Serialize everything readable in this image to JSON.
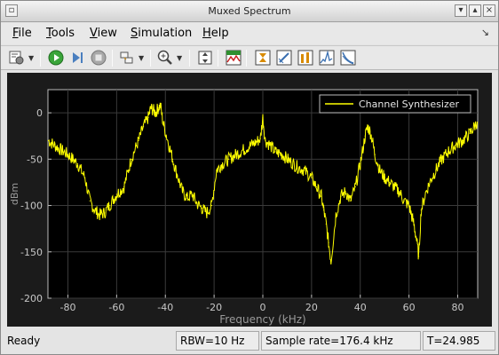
{
  "window": {
    "title": "Muxed Spectrum"
  },
  "menu": {
    "items": [
      "File",
      "Tools",
      "View",
      "Simulation",
      "Help"
    ]
  },
  "toolbar": {
    "icons": [
      "settings-icon",
      "run-icon",
      "step-forward-icon",
      "stop-icon",
      "highlight-icon",
      "zoom-in-icon",
      "fit-to-view-icon",
      "spectrum-type-icon",
      "cursor-measurements-icon",
      "channel-measurements-icon",
      "distortion-measurements-icon",
      "peak-finder-icon",
      "ccdf-icon"
    ]
  },
  "status": {
    "state": "Ready",
    "rbw": "RBW=10 Hz",
    "sample_rate": "Sample rate=176.4 kHz",
    "time": "T=24.985"
  },
  "colors": {
    "plot_background": "#000000",
    "trace": "#ffff00",
    "axes_text": "#c8c8c8",
    "grid": "#3a3a3a"
  },
  "chart_data": {
    "type": "line",
    "title": "",
    "xlabel": "Frequency (kHz)",
    "ylabel": "dBm",
    "xlim": [
      -88.2,
      88.2
    ],
    "ylim": [
      -200,
      25
    ],
    "xticks": [
      -80,
      -60,
      -40,
      -20,
      0,
      20,
      40,
      60,
      80
    ],
    "yticks": [
      0,
      -50,
      -100,
      -150,
      -200
    ],
    "grid": true,
    "legend_position": "top-right",
    "series": [
      {
        "name": "Channel Synthesizer",
        "x": [
          -88,
          -84,
          -80,
          -76,
          -73,
          -71,
          -69,
          -67,
          -65,
          -63,
          -60,
          -57,
          -54,
          -51,
          -49,
          -47,
          -46,
          -45,
          -44,
          -43,
          -42,
          -41,
          -39,
          -37,
          -35,
          -33,
          -31,
          -29,
          -27,
          -25,
          -23,
          -21,
          -19,
          -17,
          -14,
          -11,
          -8,
          -5,
          -3,
          -1,
          0,
          1,
          3,
          5,
          8,
          11,
          14,
          17,
          20,
          22,
          24,
          25,
          26,
          27,
          28,
          30,
          32,
          34,
          36,
          38,
          40,
          42,
          43,
          44,
          45,
          46,
          48,
          50,
          52,
          54,
          56,
          58,
          60,
          61,
          62,
          63,
          64,
          65,
          67,
          69,
          71,
          73,
          76,
          79,
          82,
          85,
          88
        ],
        "y": [
          -30,
          -38,
          -45,
          -55,
          -70,
          -95,
          -105,
          -110,
          -108,
          -100,
          -88,
          -80,
          -50,
          -30,
          -15,
          -5,
          5,
          3,
          0,
          5,
          8,
          -10,
          -30,
          -50,
          -68,
          -85,
          -92,
          -88,
          -98,
          -103,
          -108,
          -100,
          -62,
          -56,
          -50,
          -45,
          -40,
          -35,
          -32,
          -28,
          -5,
          -30,
          -35,
          -42,
          -45,
          -52,
          -58,
          -62,
          -70,
          -80,
          -90,
          -105,
          -120,
          -140,
          -160,
          -110,
          -90,
          -85,
          -95,
          -80,
          -55,
          -25,
          -15,
          -20,
          -30,
          -45,
          -62,
          -70,
          -75,
          -80,
          -85,
          -95,
          -100,
          -110,
          -120,
          -135,
          -155,
          -105,
          -85,
          -72,
          -62,
          -52,
          -42,
          -35,
          -30,
          -22,
          -10
        ]
      }
    ]
  }
}
